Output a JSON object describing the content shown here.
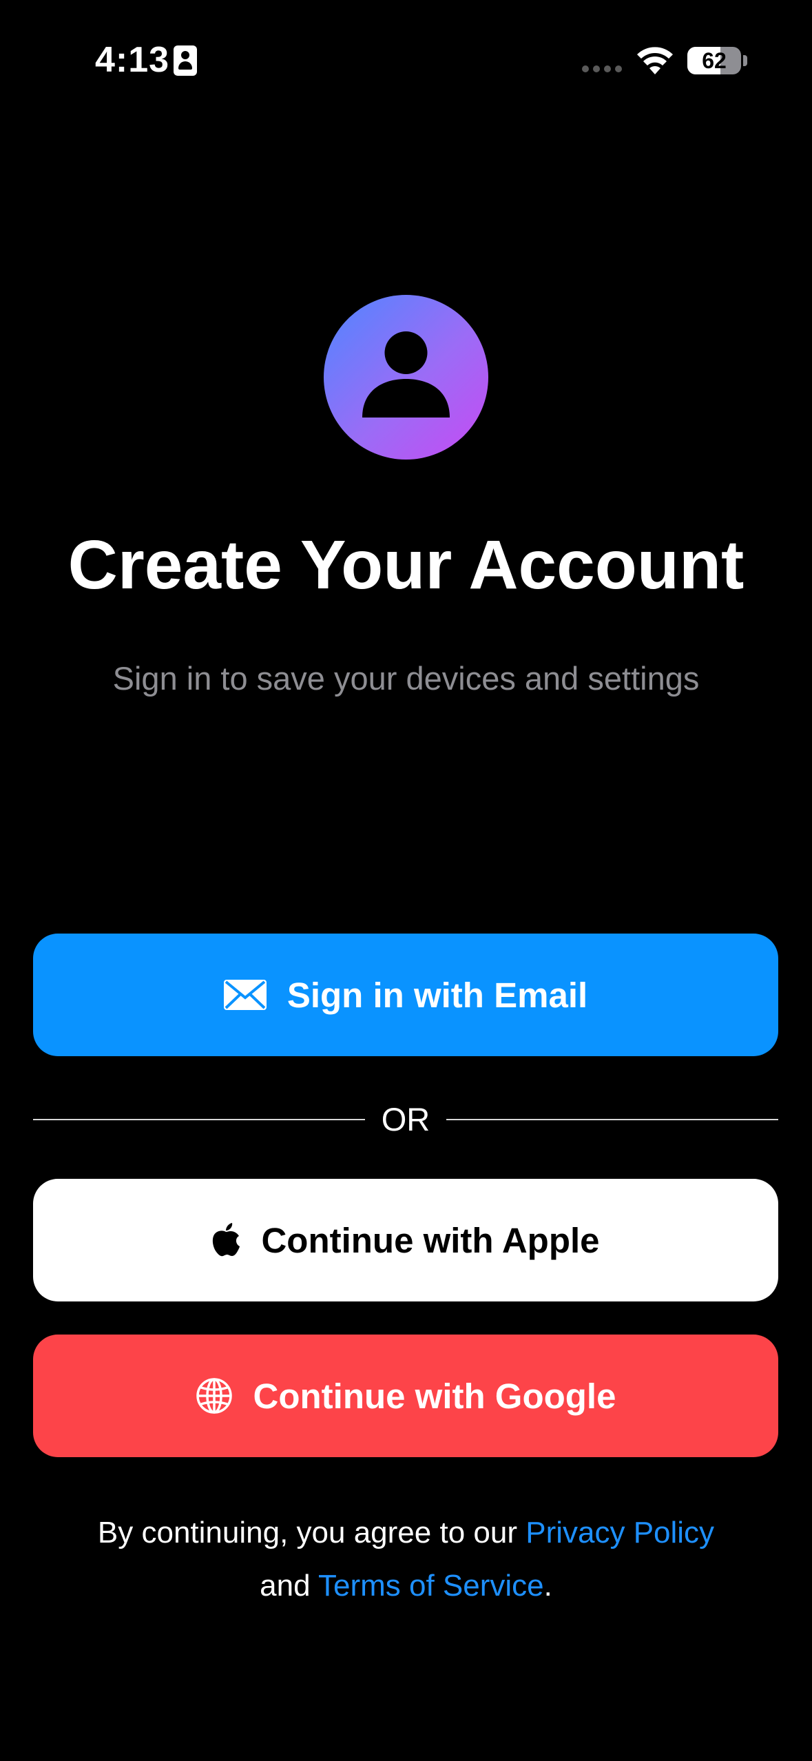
{
  "status_bar": {
    "time": "4:13",
    "battery_level": "62",
    "battery_fraction": 0.62,
    "icons": [
      "contact-card-icon",
      "cellular-signal-icon",
      "wifi-icon",
      "battery-icon"
    ]
  },
  "header": {
    "avatar_icon": "person-icon",
    "title": "Create Your Account",
    "subtitle": "Sign in to save your devices and settings"
  },
  "actions": {
    "email_label": "Sign in with Email",
    "email_icon": "envelope-icon",
    "divider_label": "OR",
    "apple_label": "Continue with Apple",
    "apple_icon": "apple-logo-icon",
    "google_label": "Continue with Google",
    "google_icon": "globe-icon"
  },
  "legal": {
    "prefix": "By continuing, you agree to our ",
    "privacy_link": "Privacy Policy",
    "middle": "and ",
    "terms_link": "Terms of Service",
    "suffix": "."
  },
  "colors": {
    "background": "#000000",
    "email_button": "#0a93ff",
    "apple_button": "#ffffff",
    "google_button": "#fd4449",
    "link": "#1e90ff",
    "subtitle": "#8e8e93",
    "avatar_gradient_start": "#4f86ff",
    "avatar_gradient_end": "#c74af2"
  }
}
